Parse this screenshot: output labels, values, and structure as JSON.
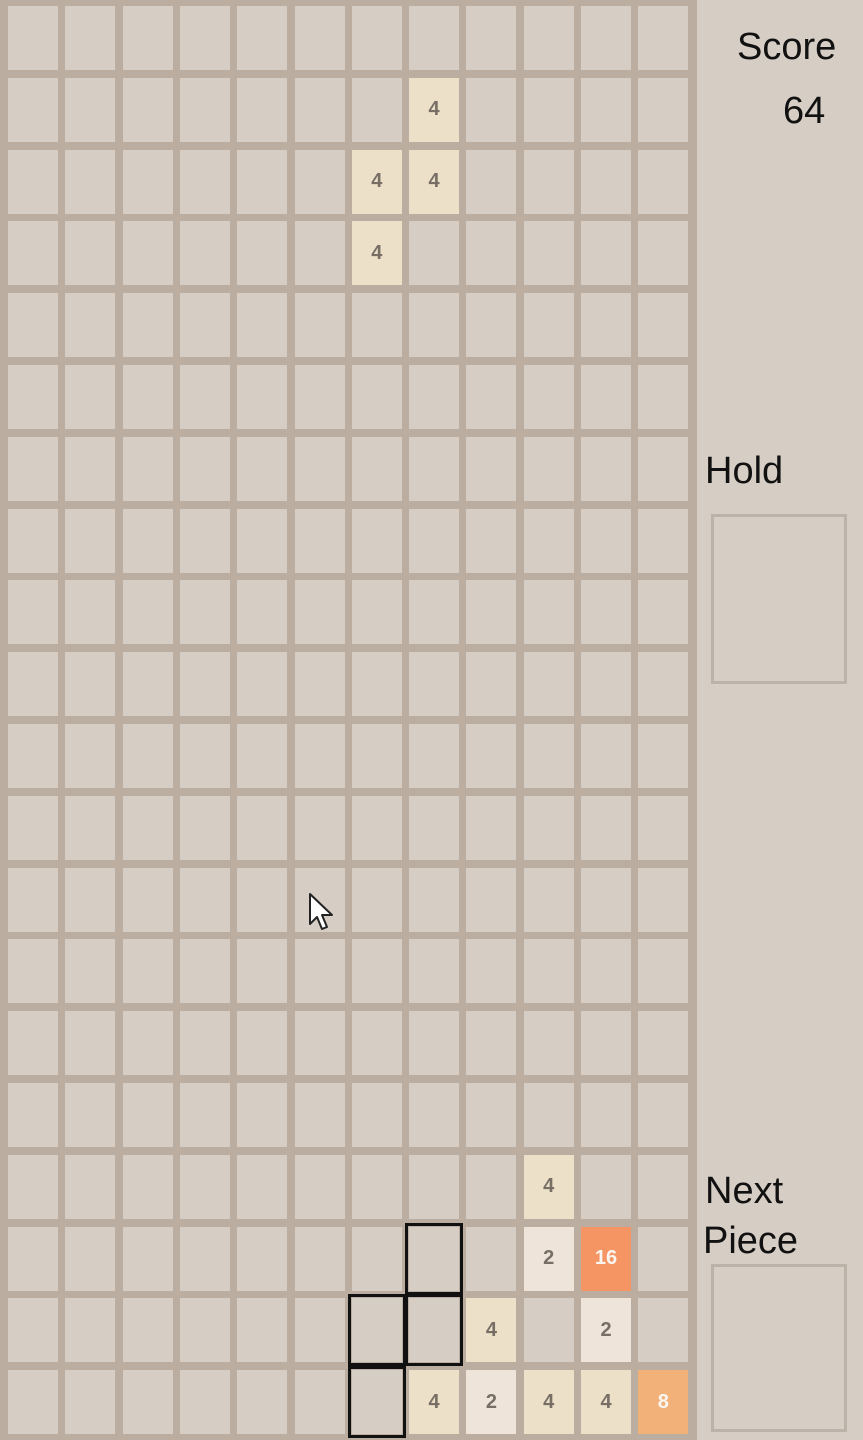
{
  "score": {
    "label": "Score",
    "value": "64"
  },
  "hold": {
    "label": "Hold"
  },
  "next_piece": {
    "label_line1": "Next",
    "label_line2": "Piece"
  },
  "board": {
    "columns": 12,
    "rows": 20,
    "tiles": [
      {
        "row": 1,
        "col": 7,
        "value": 4
      },
      {
        "row": 2,
        "col": 6,
        "value": 4
      },
      {
        "row": 2,
        "col": 7,
        "value": 4
      },
      {
        "row": 3,
        "col": 6,
        "value": 4
      },
      {
        "row": 16,
        "col": 9,
        "value": 4
      },
      {
        "row": 17,
        "col": 9,
        "value": 2
      },
      {
        "row": 17,
        "col": 10,
        "value": 16
      },
      {
        "row": 18,
        "col": 8,
        "value": 4
      },
      {
        "row": 18,
        "col": 10,
        "value": 2
      },
      {
        "row": 19,
        "col": 7,
        "value": 4
      },
      {
        "row": 19,
        "col": 8,
        "value": 2
      },
      {
        "row": 19,
        "col": 9,
        "value": 4
      },
      {
        "row": 19,
        "col": 10,
        "value": 4
      },
      {
        "row": 19,
        "col": 11,
        "value": 8
      }
    ],
    "ghost_cells": [
      {
        "row": 17,
        "col": 7
      },
      {
        "row": 18,
        "col": 6
      },
      {
        "row": 18,
        "col": 7
      },
      {
        "row": 19,
        "col": 6
      }
    ]
  },
  "colors": {
    "empty": "#d6cdc4",
    "grid": "#bbada0",
    "tile_2": "#eee4da",
    "tile_4": "#ede0c8",
    "tile_8": "#f2b179",
    "tile_16": "#f59563",
    "text_dark": "#776e65",
    "text_light": "#f9f6f2"
  }
}
